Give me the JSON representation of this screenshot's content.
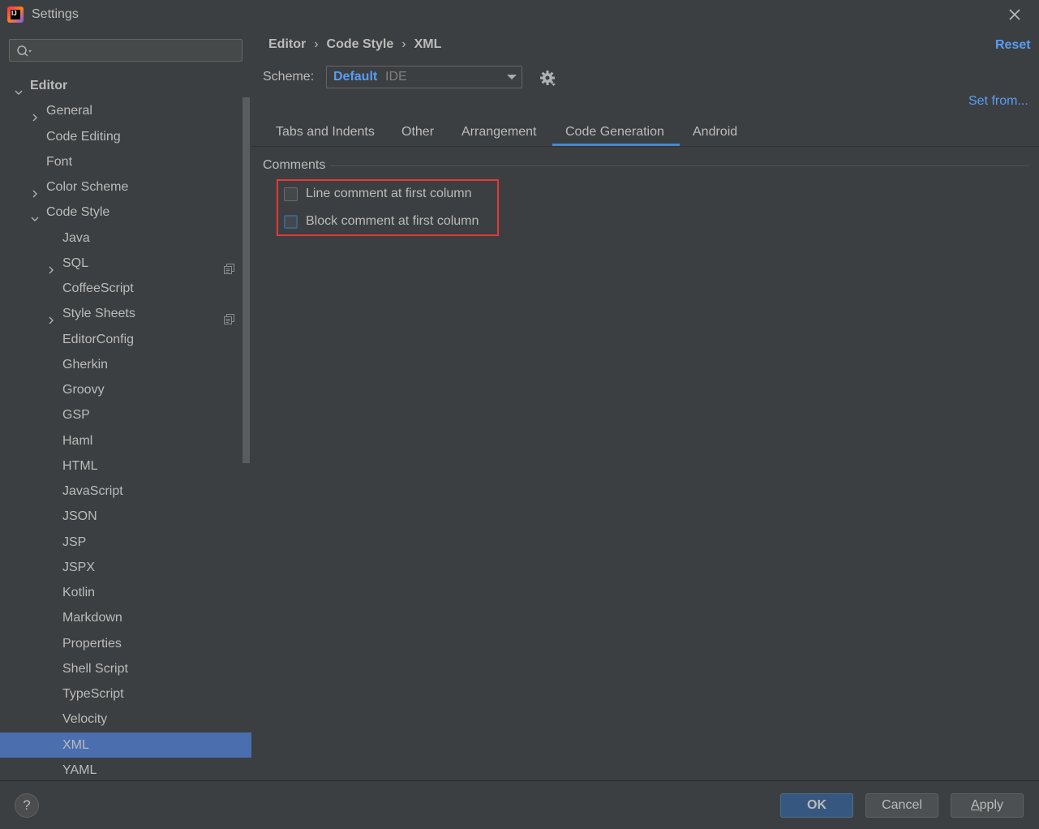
{
  "window": {
    "title": "Settings"
  },
  "search": {
    "placeholder": "",
    "value": ""
  },
  "sidebar": {
    "items": [
      {
        "label": "Editor",
        "level": 0,
        "expander": "expanded",
        "bold": true
      },
      {
        "label": "General",
        "level": 1,
        "expander": "collapsed"
      },
      {
        "label": "Code Editing",
        "level": 1,
        "expander": "none"
      },
      {
        "label": "Font",
        "level": 1,
        "expander": "none"
      },
      {
        "label": "Color Scheme",
        "level": 1,
        "expander": "collapsed"
      },
      {
        "label": "Code Style",
        "level": 1,
        "expander": "expanded"
      },
      {
        "label": "Java",
        "level": 2,
        "expander": "none"
      },
      {
        "label": "SQL",
        "level": 2,
        "expander": "collapsed",
        "copy_icon": true
      },
      {
        "label": "CoffeeScript",
        "level": 2,
        "expander": "none"
      },
      {
        "label": "Style Sheets",
        "level": 2,
        "expander": "collapsed",
        "copy_icon": true
      },
      {
        "label": "EditorConfig",
        "level": 2,
        "expander": "none"
      },
      {
        "label": "Gherkin",
        "level": 2,
        "expander": "none"
      },
      {
        "label": "Groovy",
        "level": 2,
        "expander": "none"
      },
      {
        "label": "GSP",
        "level": 2,
        "expander": "none"
      },
      {
        "label": "Haml",
        "level": 2,
        "expander": "none"
      },
      {
        "label": "HTML",
        "level": 2,
        "expander": "none"
      },
      {
        "label": "JavaScript",
        "level": 2,
        "expander": "none"
      },
      {
        "label": "JSON",
        "level": 2,
        "expander": "none"
      },
      {
        "label": "JSP",
        "level": 2,
        "expander": "none"
      },
      {
        "label": "JSPX",
        "level": 2,
        "expander": "none"
      },
      {
        "label": "Kotlin",
        "level": 2,
        "expander": "none"
      },
      {
        "label": "Markdown",
        "level": 2,
        "expander": "none"
      },
      {
        "label": "Properties",
        "level": 2,
        "expander": "none"
      },
      {
        "label": "Shell Script",
        "level": 2,
        "expander": "none"
      },
      {
        "label": "TypeScript",
        "level": 2,
        "expander": "none"
      },
      {
        "label": "Velocity",
        "level": 2,
        "expander": "none"
      },
      {
        "label": "XML",
        "level": 2,
        "expander": "none",
        "selected": true
      },
      {
        "label": "YAML",
        "level": 2,
        "expander": "none"
      }
    ]
  },
  "header": {
    "breadcrumb": [
      "Editor",
      "Code Style",
      "XML"
    ],
    "separator": "›",
    "reset_label": "Reset"
  },
  "scheme": {
    "label": "Scheme:",
    "name": "Default",
    "type": "IDE",
    "set_from_label": "Set from..."
  },
  "tabs": [
    {
      "label": "Tabs and Indents",
      "active": false
    },
    {
      "label": "Other",
      "active": false
    },
    {
      "label": "Arrangement",
      "active": false
    },
    {
      "label": "Code Generation",
      "active": true
    },
    {
      "label": "Android",
      "active": false
    }
  ],
  "comments": {
    "title": "Comments",
    "options": [
      {
        "label": "Line comment at first column",
        "checked": false
      },
      {
        "label": "Block comment at first column",
        "checked": false,
        "focused": true
      }
    ]
  },
  "footer": {
    "help_label": "?",
    "ok_label": "OK",
    "cancel_label": "Cancel",
    "apply_label": "Apply"
  },
  "colors": {
    "background": "#3c3f41",
    "selection": "#4b6eaf",
    "link": "#589df6",
    "highlight_box": "#e53935",
    "tab_underline": "#4a88c7"
  }
}
